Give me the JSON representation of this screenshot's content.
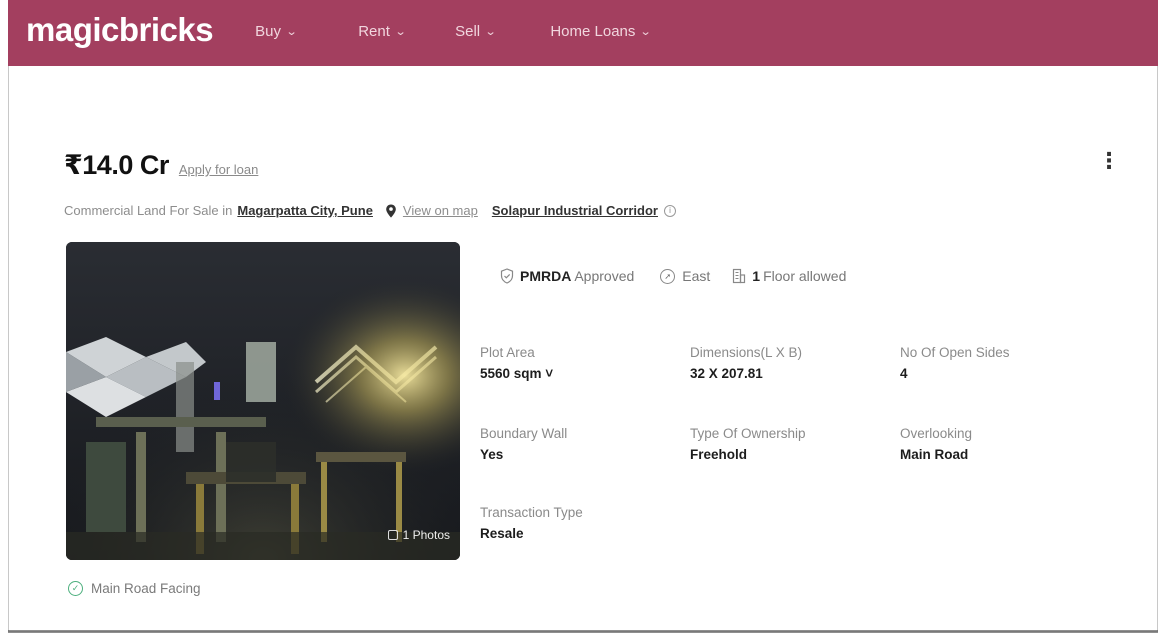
{
  "brand": {
    "logo": "magicbricks",
    "nav_color": "#a33f5f"
  },
  "nav": {
    "items": [
      {
        "label": "Buy",
        "icon": "chevron-down-icon"
      },
      {
        "label": "Rent",
        "icon": "chevron-down-icon"
      },
      {
        "label": "Sell",
        "icon": "chevron-down-icon"
      },
      {
        "label": "Home Loans",
        "icon": "chevron-down-icon"
      }
    ]
  },
  "listing": {
    "price": "₹14.0 Cr",
    "apply_loan": "Apply for loan",
    "subtitle_prefix": "Commercial Land For Sale in",
    "location": "Magarpatta City, Pune",
    "view_on_map": "View on map",
    "corridor": "Solapur Industrial Corridor",
    "photos_label": "1 Photos"
  },
  "badges": {
    "approval_bold": "PMRDA",
    "approval_text": "Approved",
    "facing": "East",
    "floors_bold": "1",
    "floors_text": "Floor allowed"
  },
  "specs": [
    {
      "label": "Plot Area",
      "value": "5560 sqm ˅"
    },
    {
      "label": "Dimensions(L X B)",
      "value": "32 X 207.81"
    },
    {
      "label": "No Of Open Sides",
      "value": "4"
    },
    {
      "label": "Boundary Wall",
      "value": "Yes"
    },
    {
      "label": "Type Of Ownership",
      "value": "Freehold"
    },
    {
      "label": "Overlooking",
      "value": "Main Road"
    },
    {
      "label": "Transaction Type",
      "value": "Resale"
    }
  ],
  "features": {
    "main_road_facing": "Main Road Facing"
  }
}
